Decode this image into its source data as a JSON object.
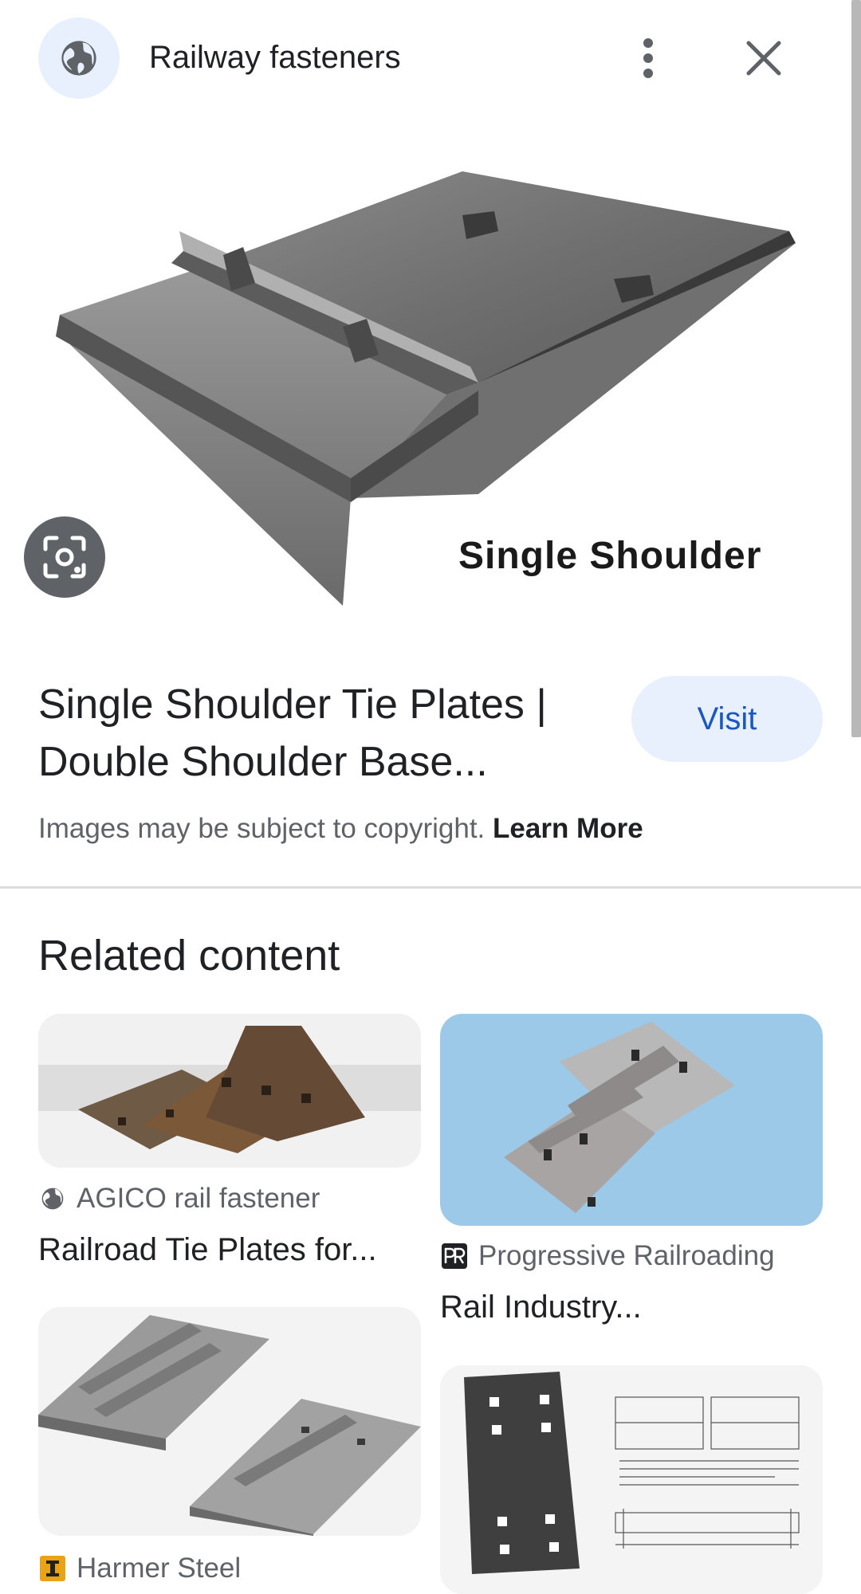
{
  "header": {
    "title": "Railway fasteners",
    "globe_icon": "globe-icon",
    "more_icon": "more-vert-icon",
    "close_icon": "close-icon"
  },
  "main_image": {
    "caption": "Single Shoulder",
    "lens_icon": "lens-search-icon"
  },
  "result": {
    "title_line1": "Single Shoulder Tie Plates |",
    "title_line2": "Double Shoulder Base...",
    "visit_label": "Visit",
    "copyright": "Images may be subject to copyright.",
    "learn_more": "Learn More"
  },
  "related": {
    "heading": "Related content",
    "cards": [
      {
        "source": "AGICO rail fastener",
        "title": "Railroad Tie Plates for...",
        "icon": "globe-icon"
      },
      {
        "source": "Progressive Railroading",
        "title": "Rail Industry...",
        "icon": "pr-logo-icon"
      },
      {
        "source": "Harmer Steel",
        "title": "",
        "icon": "rail-logo-icon"
      },
      {
        "source": "",
        "title": "",
        "icon": ""
      }
    ]
  },
  "colors": {
    "accent": "#1a56c4",
    "chip_bg": "#e8f0fe",
    "divider": "#dadce0",
    "lens_bg": "#5f6368",
    "sky_bg": "#9cc9e8"
  }
}
